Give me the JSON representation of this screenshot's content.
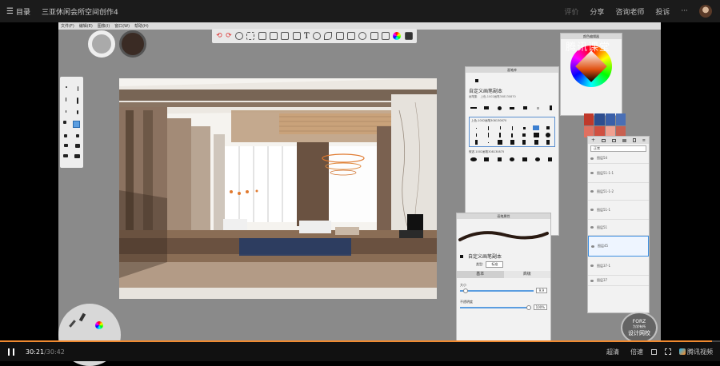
{
  "topbar": {
    "menu_label": "目录",
    "title": "三亚休闲会所空间创作4",
    "actions": [
      "评价",
      "分享",
      "咨询老师",
      "投诉",
      "···"
    ]
  },
  "sketchbook": {
    "menus": [
      "文件(F)",
      "编辑(E)",
      "图像(I)",
      "窗口(W)",
      "帮助(H)"
    ],
    "brush_panel": {
      "title": "画笔库",
      "brush_name": "自定义画笔副本",
      "brush_sub": "画笔集",
      "brush_sub2": "上色-1002画笔308130870",
      "set_label": "上色-1002画笔308130870",
      "set2_label": "叙述-1002画笔308130875"
    },
    "props_panel": {
      "title": "画笔属性",
      "brush_name": "自定义画笔副本",
      "type_label": "类型:",
      "type_value": "标准",
      "tab_basic": "基本",
      "tab_advanced": "高级",
      "size_label": "大小",
      "size_value": "9.9",
      "opacity_label": "不透明度",
      "opacity_value": "100%"
    },
    "color_panel": {
      "title": "颜色编辑器"
    },
    "layers": {
      "mode": "正常",
      "items": [
        "图层54",
        "图层51-1-1",
        "图层51-1-2",
        "图层51-1",
        "图层51",
        "图层45",
        "图层37-1",
        "图层37"
      ]
    },
    "swatches": [
      "#c0392b",
      "#2e4e8f",
      "#3a5fa8",
      "#4a6fb5",
      "#e07060",
      "#d05040",
      "#f0a090",
      "#c86050",
      "#e8806c"
    ]
  },
  "watermark": "腾讯课堂",
  "badge": {
    "line1": "FORZ",
    "line2": "为学有所",
    "line3": "设计网校"
  },
  "player": {
    "time_current": "30:21",
    "time_total": "30:42",
    "quality": "超清",
    "speed": "倍速",
    "logo": "腾讯视频",
    "progress": 0.989
  }
}
